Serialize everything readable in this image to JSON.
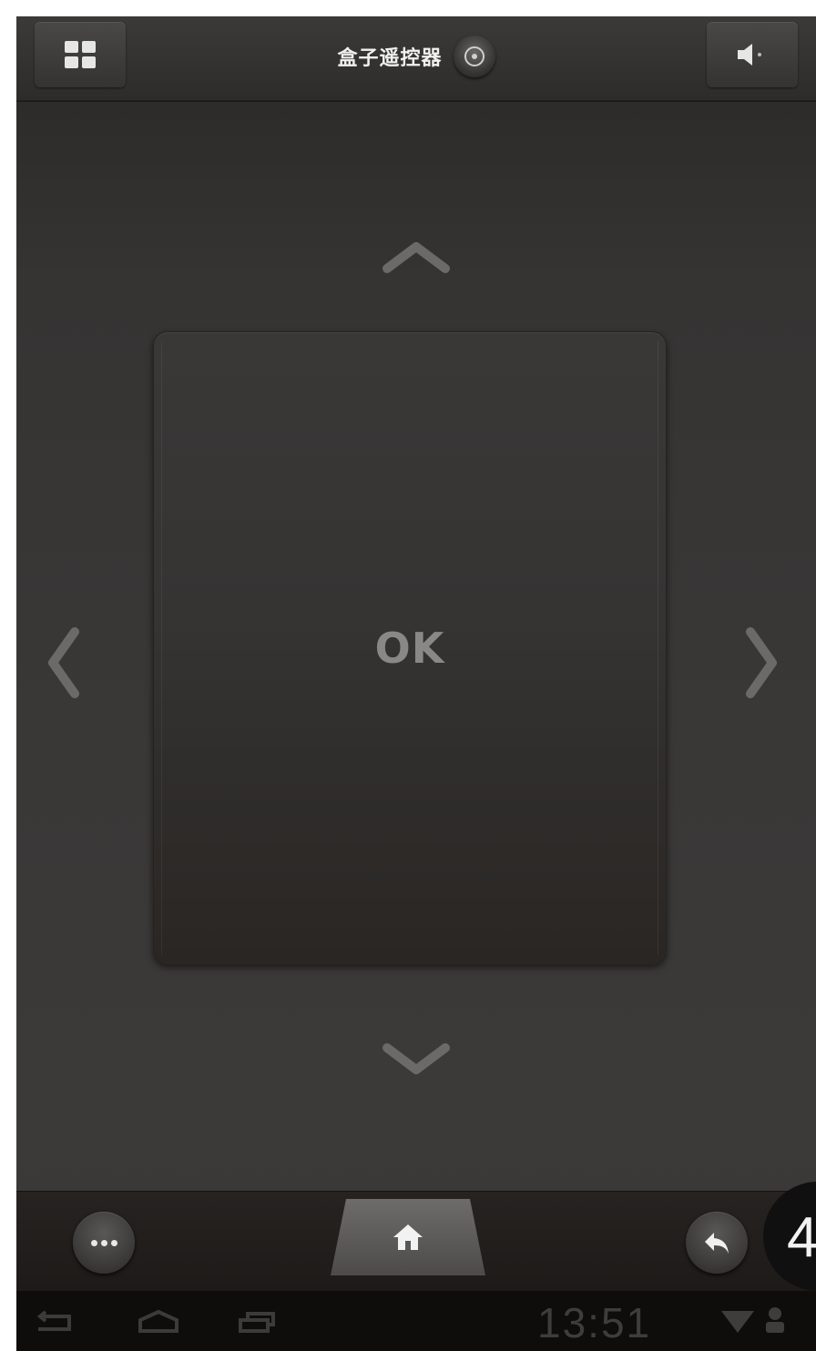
{
  "app": {
    "title": "盒子遥控器"
  },
  "topbar": {
    "menu_icon": "grid-icon",
    "title_icon": "disc-icon",
    "volume_icon": "volume-icon"
  },
  "dpad": {
    "ok_label": "OK",
    "up_icon": "chevron-up-icon",
    "down_icon": "chevron-down-icon",
    "left_icon": "chevron-left-icon",
    "right_icon": "chevron-right-icon"
  },
  "bottombar": {
    "more_icon": "more-dots-icon",
    "home_icon": "home-icon",
    "back_icon": "back-arrow-icon"
  },
  "badge": {
    "label": "4"
  },
  "system": {
    "clock": "13:51",
    "nav_icons": [
      "back-icon",
      "home-outline-icon",
      "recent-apps-icon"
    ],
    "status_icons": [
      "wifi-icon",
      "user-icon"
    ]
  },
  "colors": {
    "background": "#3a3837",
    "pad": "#363433",
    "text_light": "#f0f0f0",
    "ok_text": "#8a8886"
  }
}
